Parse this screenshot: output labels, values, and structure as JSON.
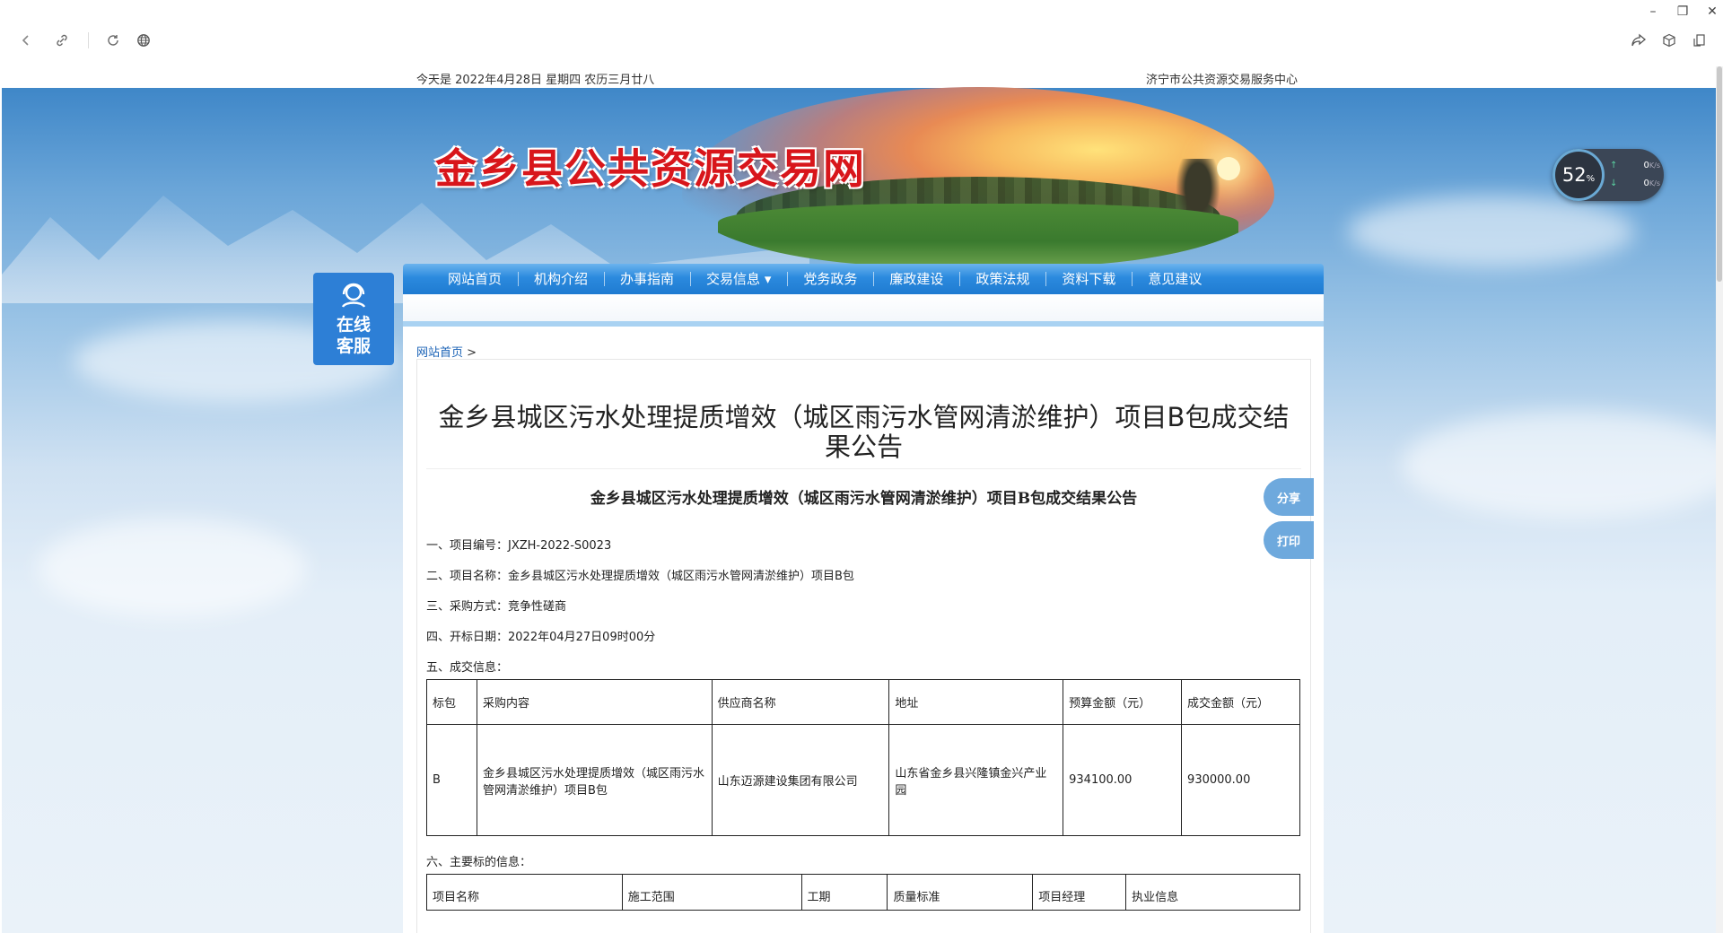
{
  "browser": {
    "controls": {
      "back": "back-icon",
      "link": "link-icon",
      "reload": "reload-icon",
      "globe": "globe-icon",
      "share": "share-icon",
      "cube": "cube-icon",
      "reader": "reader-icon"
    },
    "window": {
      "minimize": "–",
      "restore": "❐",
      "close": "✕"
    }
  },
  "topbar": {
    "date": "今天是 2022年4月28日 星期四 农历三月廿八",
    "org": "济宁市公共资源交易服务中心"
  },
  "header": {
    "site_title": "金乡县公共资源交易网"
  },
  "service": {
    "line1": "在线",
    "line2": "客服"
  },
  "nav": {
    "items": [
      {
        "label": "网站首页"
      },
      {
        "label": "机构介绍"
      },
      {
        "label": "办事指南"
      },
      {
        "label": "交易信息 ▾"
      },
      {
        "label": "党务政务"
      },
      {
        "label": "廉政建设"
      },
      {
        "label": "政策法规"
      },
      {
        "label": "资料下载"
      },
      {
        "label": "意见建议"
      }
    ]
  },
  "breadcrumb": {
    "home": "网站首页",
    "sep": ">"
  },
  "announcement": {
    "title": "金乡县城区污水处理提质增效（城区雨污水管网清淤维护）项目B包成交结果公告",
    "doc_title": "金乡县城区污水处理提质增效（城区雨污水管网清淤维护）项目B包成交结果公告",
    "share": "分享",
    "print": "打印",
    "lines": [
      "一、项目编号：JXZH-2022-S0023",
      "二、项目名称：金乡县城区污水处理提质增效（城区雨污水管网清淤维护）项目B包",
      "三、采购方式：竞争性磋商",
      "四、开标日期：2022年04月27日09时00分",
      "五、成交信息："
    ],
    "deal_table": {
      "headers": [
        "标包",
        "采购内容",
        "供应商名称",
        "地址",
        "预算金额（元）",
        "成交金额（元）"
      ],
      "rows": [
        [
          "B",
          "金乡县城区污水处理提质增效（城区雨污水管网清淤维护）项目B包",
          "山东迈源建设集团有限公司",
          "山东省金乡县兴隆镇金兴产业园",
          "934100.00",
          "930000.00"
        ]
      ]
    },
    "section6": "六、主要标的信息：",
    "main_table": {
      "headers": [
        "项目名称",
        "施工范围",
        "工期",
        "质量标准",
        "项目经理",
        "执业信息"
      ]
    }
  },
  "speed_widget": {
    "percent": "52",
    "unit": "%",
    "up": "0",
    "down": "0",
    "rate_unit": "K/s"
  }
}
